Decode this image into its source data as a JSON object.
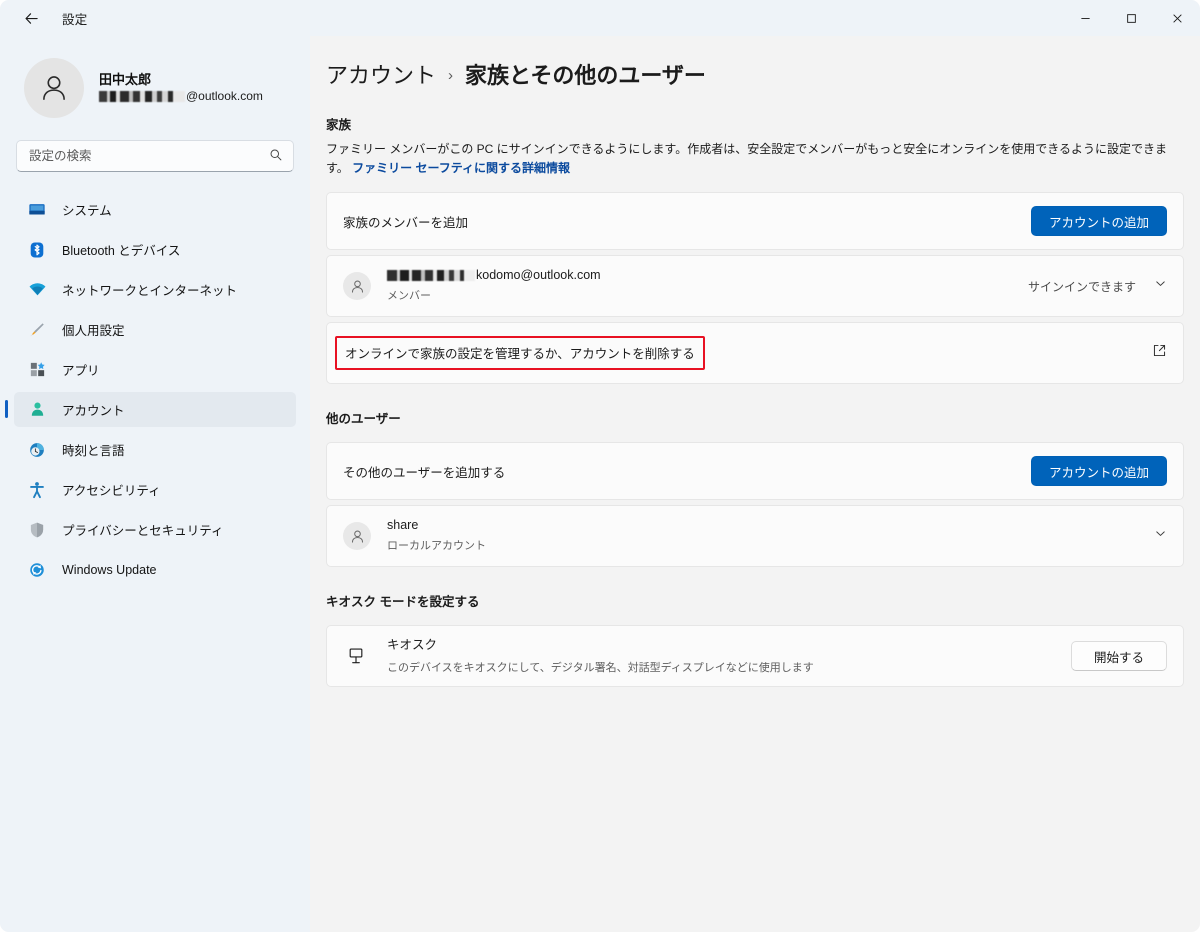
{
  "window": {
    "app_title": "設定",
    "back_icon": "arrow-left-icon",
    "controls": {
      "minimize": "minimize-icon",
      "maximize": "maximize-icon",
      "close": "close-icon"
    }
  },
  "sidebar": {
    "profile": {
      "name": "田中太郎",
      "email_suffix": "@outlook.com",
      "email_redacted": true,
      "avatar_icon": "person-icon"
    },
    "search": {
      "placeholder": "設定の検索",
      "value": "",
      "icon": "search-icon"
    },
    "items": [
      {
        "label": "システム",
        "icon": "system-icon",
        "active": false
      },
      {
        "label": "Bluetooth とデバイス",
        "icon": "bluetooth-icon",
        "active": false
      },
      {
        "label": "ネットワークとインターネット",
        "icon": "wifi-icon",
        "active": false
      },
      {
        "label": "個人用設定",
        "icon": "brush-icon",
        "active": false
      },
      {
        "label": "アプリ",
        "icon": "apps-icon",
        "active": false
      },
      {
        "label": "アカウント",
        "icon": "account-icon",
        "active": true
      },
      {
        "label": "時刻と言語",
        "icon": "clock-icon",
        "active": false
      },
      {
        "label": "アクセシビリティ",
        "icon": "accessibility-icon",
        "active": false
      },
      {
        "label": "プライバシーとセキュリティ",
        "icon": "shield-icon",
        "active": false
      },
      {
        "label": "Windows Update",
        "icon": "update-icon",
        "active": false
      }
    ]
  },
  "main": {
    "breadcrumb": {
      "parent": "アカウント",
      "separator": "›",
      "current": "家族とその他のユーザー"
    },
    "family": {
      "section_title": "家族",
      "description": "ファミリー メンバーがこの PC にサインインできるようにします。作成者は、安全設定でメンバーがもっと安全にオンラインを使用できるように設定できます。",
      "link_text": "ファミリー セーフティに関する詳細情報",
      "add_member": {
        "label": "家族のメンバーを追加",
        "button": "アカウントの追加"
      },
      "member": {
        "email_suffix": "kodomo@outlook.com",
        "email_redacted": true,
        "role": "メンバー",
        "status": "サインインできます",
        "avatar_icon": "person-icon",
        "chevron_icon": "chevron-down-icon"
      },
      "manage_online": {
        "label": "オンラインで家族の設定を管理するか、アカウントを削除する",
        "highlighted": true,
        "highlight_color": "#e81123",
        "external_icon": "external-link-icon"
      }
    },
    "other_users": {
      "section_title": "他のユーザー",
      "add_user": {
        "label": "その他のユーザーを追加する",
        "button": "アカウントの追加"
      },
      "user": {
        "name": "share",
        "type": "ローカルアカウント",
        "avatar_icon": "person-icon",
        "chevron_icon": "chevron-down-icon"
      }
    },
    "kiosk": {
      "section_title": "キオスク モードを設定する",
      "title": "キオスク",
      "description": "このデバイスをキオスクにして、デジタル署名、対話型ディスプレイなどに使用します",
      "button": "開始する",
      "icon": "kiosk-display-icon"
    }
  },
  "colors": {
    "accent": "#0063ba",
    "link": "#0b4a9e",
    "highlight": "#e81123",
    "sidebar_bg": "#eef3f8",
    "content_bg": "#f3f3f3",
    "card_bg": "#fbfbfb"
  }
}
